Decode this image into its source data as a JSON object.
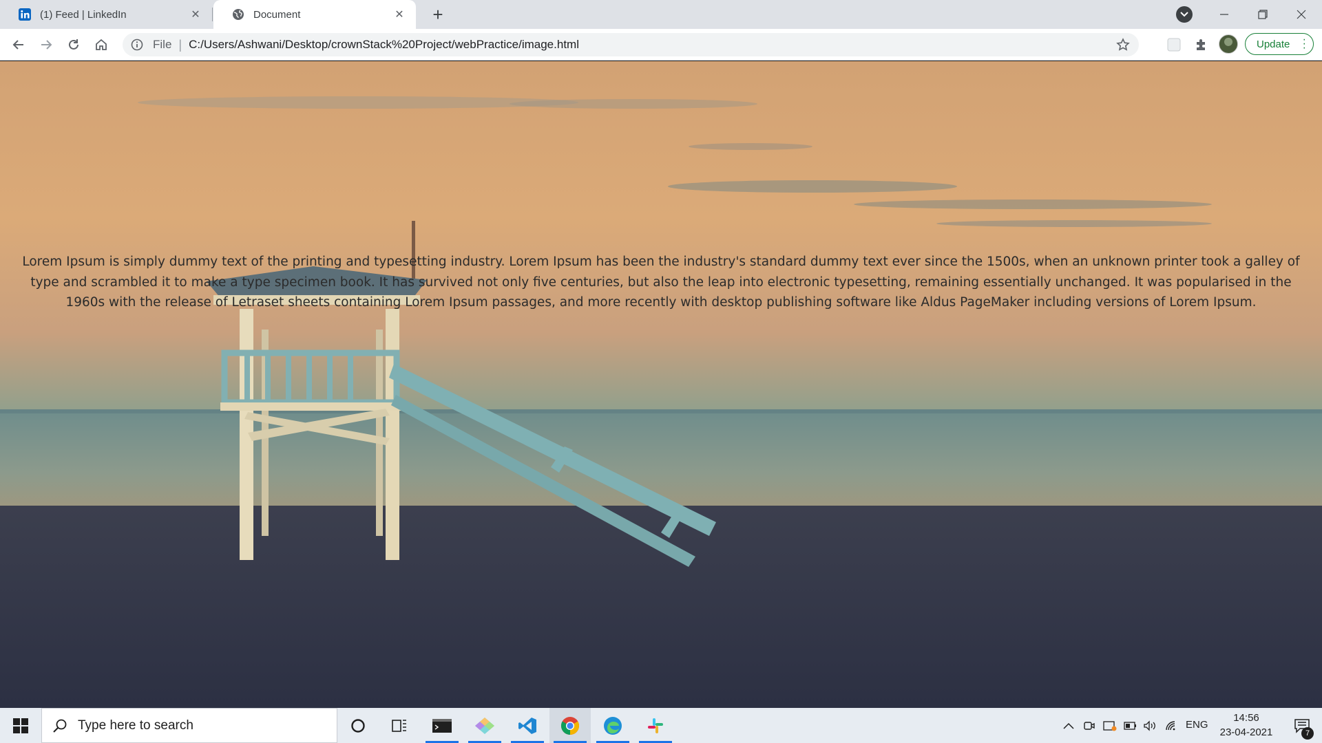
{
  "browser": {
    "tabs": [
      {
        "title": "(1) Feed | LinkedIn",
        "icon": "linkedin-icon",
        "active": false
      },
      {
        "title": "Document",
        "icon": "globe-icon",
        "active": true
      }
    ],
    "address_bar": {
      "scheme_label": "File",
      "divider": "|",
      "url": "C:/Users/Ashwani/Desktop/crownStack%20Project/webPractice/image.html"
    },
    "update_label": "Update"
  },
  "page": {
    "paragraph": "Lorem Ipsum is simply dummy text of the printing and typesetting industry. Lorem Ipsum has been the industry's standard dummy text ever since the 1500s, when an unknown printer took a galley of type and scrambled it to make a type specimen book. It has survived not only five centuries, but also the leap into electronic typesetting, remaining essentially unchanged. It was popularised in the 1960s with the release of Letraset sheets containing Lorem Ipsum passages, and more recently with desktop publishing software like Aldus PageMaker including versions of Lorem Ipsum."
  },
  "taskbar": {
    "search_placeholder": "Type here to search",
    "pinned_apps": [
      "cortana-icon",
      "task-view-icon",
      "terminal-icon",
      "git-kraken-icon",
      "vscode-icon",
      "chrome-icon",
      "edge-icon",
      "slack-icon"
    ],
    "language": "ENG",
    "time": "14:56",
    "date": "23-04-2021",
    "notification_count": "7"
  },
  "colors": {
    "tabstrip": "#dee1e6",
    "accent_green": "#188038",
    "taskbar": "#e7ecf2",
    "sky_top": "#d8a877",
    "sea": "#6a8a88",
    "sand": "#2f3447"
  }
}
